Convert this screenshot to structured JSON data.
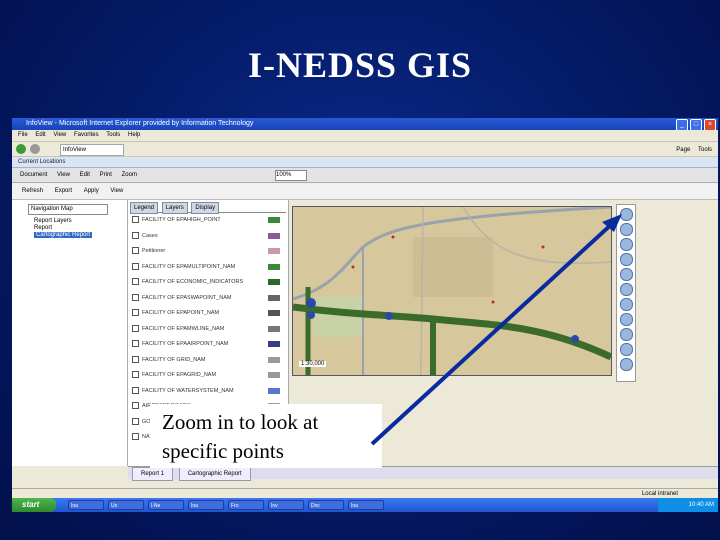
{
  "slide": {
    "title": "I-NEDSS GIS",
    "caption": "Zoom in to look at\nspecific points"
  },
  "browser": {
    "window_title": "InfoView - Microsoft Internet Explorer provided by Information Technology",
    "menu_items": [
      "File",
      "Edit",
      "View",
      "Favorites",
      "Tools",
      "Help"
    ],
    "tab_label": "InfoView",
    "page_label": "Page",
    "tools_label": "Tools"
  },
  "app": {
    "breadcrumb": "Current Locations",
    "toolbar_items": [
      "Document",
      "View",
      "Edit",
      "Print",
      "Zoom"
    ],
    "zoom_value": "100%",
    "actions": [
      "Refresh",
      "Export",
      "Apply",
      "View"
    ],
    "left_dropdown": "Navigation Map",
    "tree": [
      "Report Layers",
      "Report",
      "Cartographic Report"
    ],
    "layer_tabs": [
      "Legend",
      "Layers",
      "Display"
    ],
    "layers": [
      "FACILITY OF EPAHIGH_POINT",
      "Cases",
      "Petitioner",
      "FACILITY OF EPAMULTIPOINT_NAM",
      "FACILITY OF ECONOMIC_INDICATORS",
      "FACILITY OF EPASWAPOINT_NAM",
      "FACILITY OF EPAPOINT_NAM",
      "FACILITY OF EPAMWLINE_NAM",
      "FACILITY OF EPAAIRPOINT_NAM",
      "FACILITY OF GRID_NAM",
      "FACILITY OF EPAGRID_NAM",
      "FACILITY OF WATERSYSTEM_NAM",
      "AIRCRAFT ROADS",
      "GOLF COURSE",
      "NATIVE AMERICAN"
    ],
    "bottom_tabs": [
      "Report 1",
      "Cartographic Report"
    ],
    "status": "Local intranet",
    "scale_label": "1:30,000"
  },
  "taskbar": {
    "start_label": "start",
    "items": [
      "Ina",
      "Un",
      "I-Ne",
      "Ina",
      "Fro",
      "Inv",
      "Doc",
      "Ina"
    ],
    "clock": "10:40 AM"
  },
  "colors": {
    "slide_bg": "#041a66",
    "arrow": "#0a2aa0",
    "road_green": "#3a6b2a",
    "road_gray": "#8a8f99"
  }
}
